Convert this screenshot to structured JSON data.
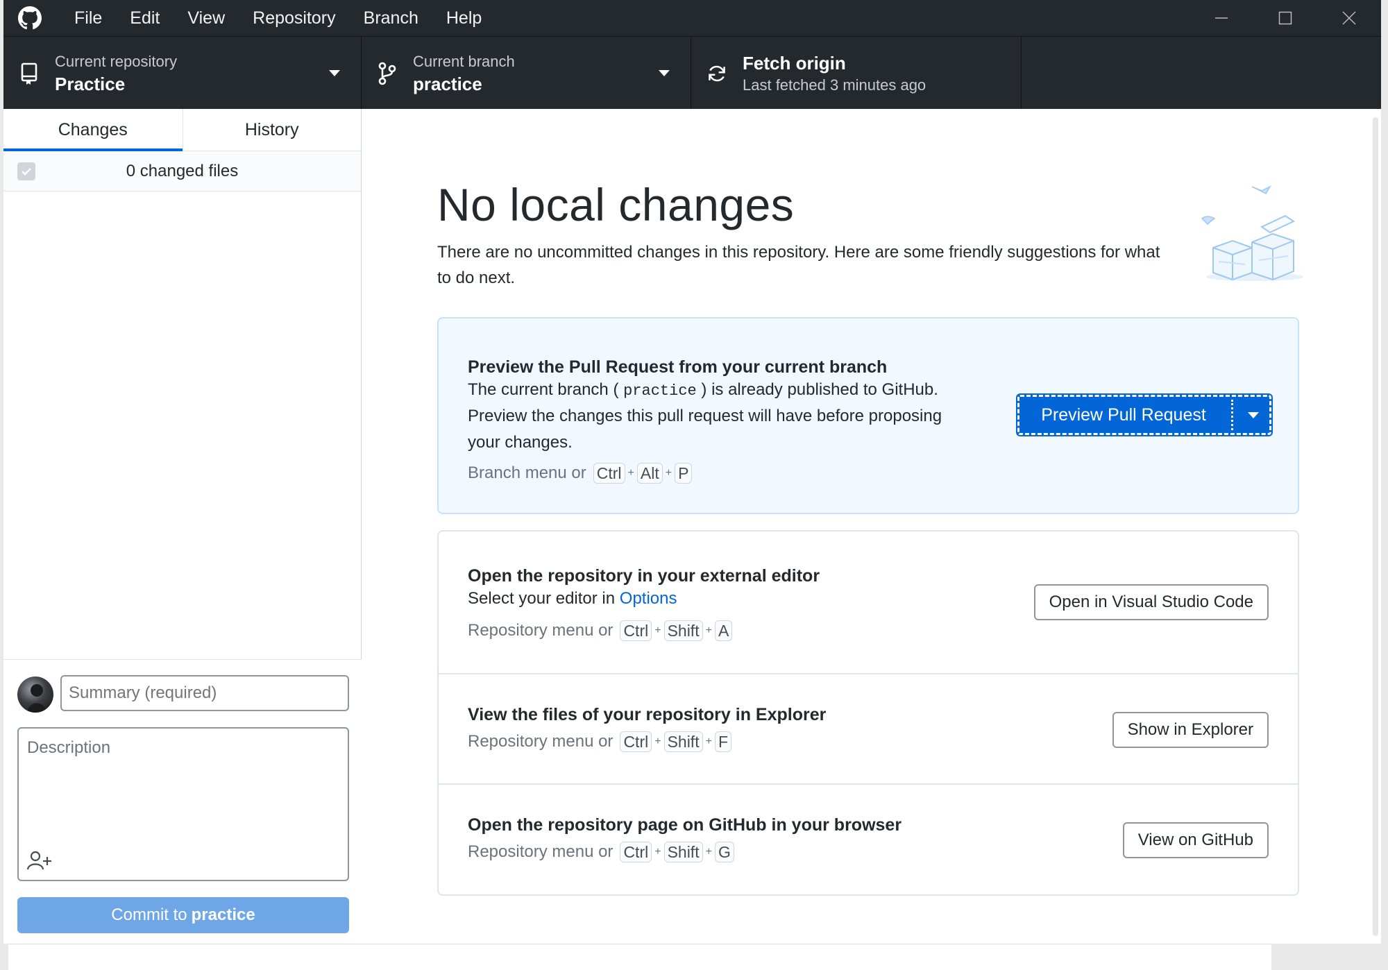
{
  "menu": {
    "items": [
      "File",
      "Edit",
      "View",
      "Repository",
      "Branch",
      "Help"
    ]
  },
  "toolbar": {
    "repo_label": "Current repository",
    "repo_name": "Practice",
    "branch_label": "Current branch",
    "branch_name": "practice",
    "fetch_title": "Fetch origin",
    "fetch_sub": "Last fetched 3 minutes ago"
  },
  "sidebar": {
    "tabs": [
      "Changes",
      "History"
    ],
    "active_tab": "Changes",
    "changed_files": "0 changed files",
    "summary_placeholder": "Summary (required)",
    "description_placeholder": "Description",
    "commit_prefix": "Commit to",
    "commit_branch": "practice"
  },
  "main": {
    "title": "No local changes",
    "subtitle": "There are no uncommitted changes in this repository. Here are some friendly suggestions for what to do next.",
    "pr_card": {
      "title": "Preview the Pull Request from your current branch",
      "text_1": "The current branch (",
      "branch_code": "practice",
      "text_2": ") is already published to GitHub.",
      "text_3": "Preview the changes this pull request will have before proposing",
      "text_4": "your changes.",
      "shortcut_prefix": "Branch menu or",
      "keys": [
        "Ctrl",
        "Alt",
        "P"
      ],
      "button": "Preview Pull Request"
    },
    "editor_row": {
      "title": "Open the repository in your external editor",
      "text": "Select your editor in",
      "link": "Options",
      "shortcut_prefix": "Repository menu or",
      "keys": [
        "Ctrl",
        "Shift",
        "A"
      ],
      "button": "Open in Visual Studio Code"
    },
    "explorer_row": {
      "title": "View the files of your repository in Explorer",
      "shortcut_prefix": "Repository menu or",
      "keys": [
        "Ctrl",
        "Shift",
        "F"
      ],
      "button": "Show in Explorer"
    },
    "github_row": {
      "title": "Open the repository page on GitHub in your browser",
      "shortcut_prefix": "Repository menu or",
      "keys": [
        "Ctrl",
        "Shift",
        "G"
      ],
      "button": "View on GitHub"
    }
  },
  "colors": {
    "titlebar": "#24292e",
    "accent": "#0366d6",
    "commit_button": "#6fa6e8",
    "pr_card_bg": "#f1f8ff"
  },
  "icons": [
    "github-logo-icon",
    "repo-icon",
    "branch-icon",
    "sync-icon",
    "caret-down-icon",
    "minimize-icon",
    "maximize-icon",
    "close-icon",
    "checkbox-icon",
    "add-coauthor-icon",
    "illustration"
  ]
}
